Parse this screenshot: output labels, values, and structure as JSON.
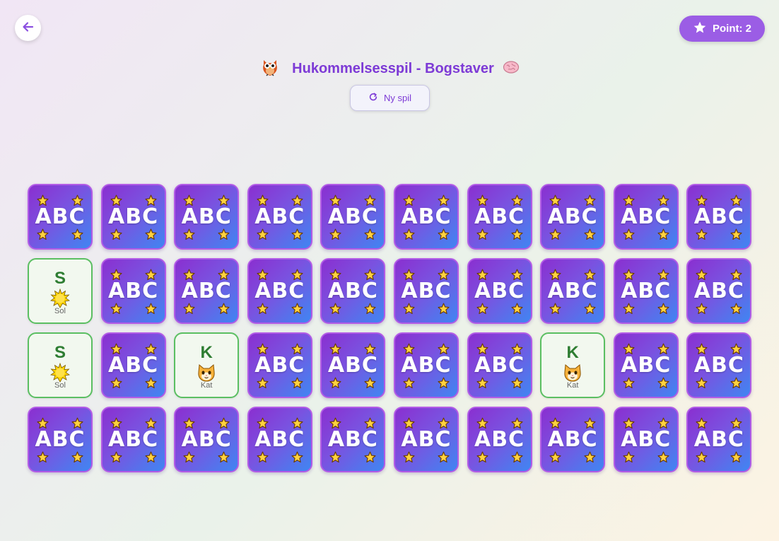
{
  "header": {
    "back_icon": "arrow-left-icon",
    "points_icon": "star-icon",
    "points_label": "Point: 2",
    "title": "Hukommelsesspil - Bogstaver",
    "title_left_icon": "owl-icon",
    "title_right_icon": "brain-icon",
    "new_game_icon": "refresh-icon",
    "new_game_label": "Ny spil"
  },
  "colors": {
    "accent": "#9b5de5",
    "title": "#7d3ad6",
    "card_back_start": "#8a2fd0",
    "card_back_end": "#3f86f2",
    "matched_border": "#5bbf62",
    "letter": "#2e7d32"
  },
  "board": {
    "columns": 10,
    "rows": 4,
    "card_back_text": "ABC",
    "card_back_icon": "star-icon",
    "cards": [
      {
        "state": "hidden"
      },
      {
        "state": "hidden"
      },
      {
        "state": "hidden"
      },
      {
        "state": "hidden"
      },
      {
        "state": "hidden"
      },
      {
        "state": "hidden"
      },
      {
        "state": "hidden"
      },
      {
        "state": "hidden"
      },
      {
        "state": "hidden"
      },
      {
        "state": "hidden"
      },
      {
        "state": "revealed",
        "letter": "S",
        "word": "Sol",
        "icon": "sun-icon"
      },
      {
        "state": "hidden"
      },
      {
        "state": "hidden"
      },
      {
        "state": "hidden"
      },
      {
        "state": "hidden"
      },
      {
        "state": "hidden"
      },
      {
        "state": "hidden"
      },
      {
        "state": "hidden"
      },
      {
        "state": "hidden"
      },
      {
        "state": "hidden"
      },
      {
        "state": "revealed",
        "letter": "S",
        "word": "Sol",
        "icon": "sun-icon"
      },
      {
        "state": "hidden"
      },
      {
        "state": "revealed",
        "letter": "K",
        "word": "Kat",
        "icon": "cat-icon"
      },
      {
        "state": "hidden"
      },
      {
        "state": "hidden"
      },
      {
        "state": "hidden"
      },
      {
        "state": "hidden"
      },
      {
        "state": "revealed",
        "letter": "K",
        "word": "Kat",
        "icon": "cat-icon"
      },
      {
        "state": "hidden"
      },
      {
        "state": "hidden"
      },
      {
        "state": "hidden"
      },
      {
        "state": "hidden"
      },
      {
        "state": "hidden"
      },
      {
        "state": "hidden"
      },
      {
        "state": "hidden"
      },
      {
        "state": "hidden"
      },
      {
        "state": "hidden"
      },
      {
        "state": "hidden"
      },
      {
        "state": "hidden"
      },
      {
        "state": "hidden"
      }
    ]
  }
}
